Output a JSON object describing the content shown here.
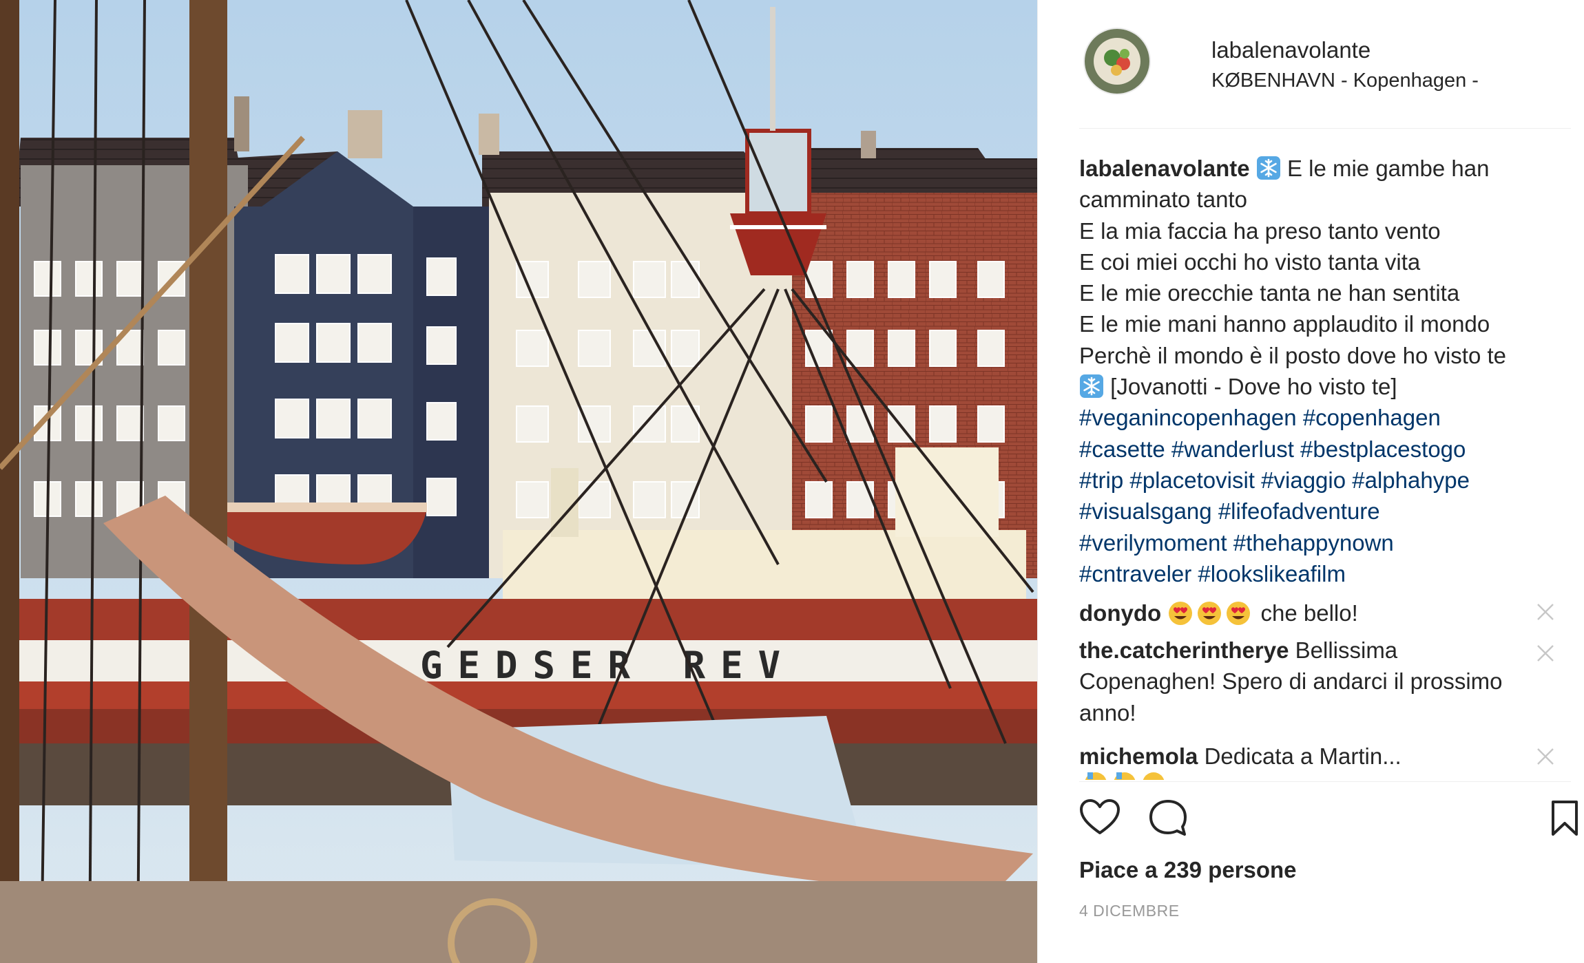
{
  "post": {
    "username": "labalenavolante",
    "location": "KØBENHAVN - Kopenhagen -",
    "photo_alt": "GEDSER REV",
    "caption": {
      "username": "labalenavolante",
      "lines": [
        "E le mie gambe han",
        "camminato tanto",
        "E la mia faccia ha preso tanto vento",
        "E coi miei occhi ho visto tanta vita",
        "E le mie orecchie tanta ne han sentita",
        "E le mie mani hanno applaudito il mondo",
        "Perchè il mondo è il posto dove ho visto te",
        "[Jovanotti - Dove ho visto te]"
      ],
      "hashtag_lines": [
        [
          "#veganincopenhagen",
          "#copenhagen"
        ],
        [
          "#casette",
          "#wanderlust",
          "#bestplacestogo"
        ],
        [
          "#trip",
          "#placetovisit",
          "#viaggio",
          "#alphahype"
        ],
        [
          "#visualsgang",
          "#lifeofadventure"
        ],
        [
          "#verilymoment",
          "#thehappynown"
        ],
        [
          "#cntraveler",
          "#lookslikeafilm"
        ]
      ]
    },
    "comments": [
      {
        "user": "donydo",
        "text": "che bello!",
        "emoji_count": 3,
        "emoji": "heart-eyes-emoji"
      },
      {
        "user": "the.catcherintherye",
        "text_lines": [
          "Bellissima",
          "Copenaghen! Spero di andarci il prossimo",
          "anno!"
        ]
      },
      {
        "user": "michemola",
        "text": "Dedicata a Martin..."
      }
    ],
    "likes": "Piace a 239 persone",
    "date": "4 DICEMBRE",
    "icons": {
      "like": "heart-icon",
      "comment": "comment-icon",
      "save": "bookmark-icon",
      "remove": "close-icon",
      "snowflake": "snowflake-emoji"
    },
    "colors": {
      "hashtag": "#003569",
      "text": "#262626",
      "muted": "#999999",
      "hull_red": "#a33a2a"
    }
  }
}
